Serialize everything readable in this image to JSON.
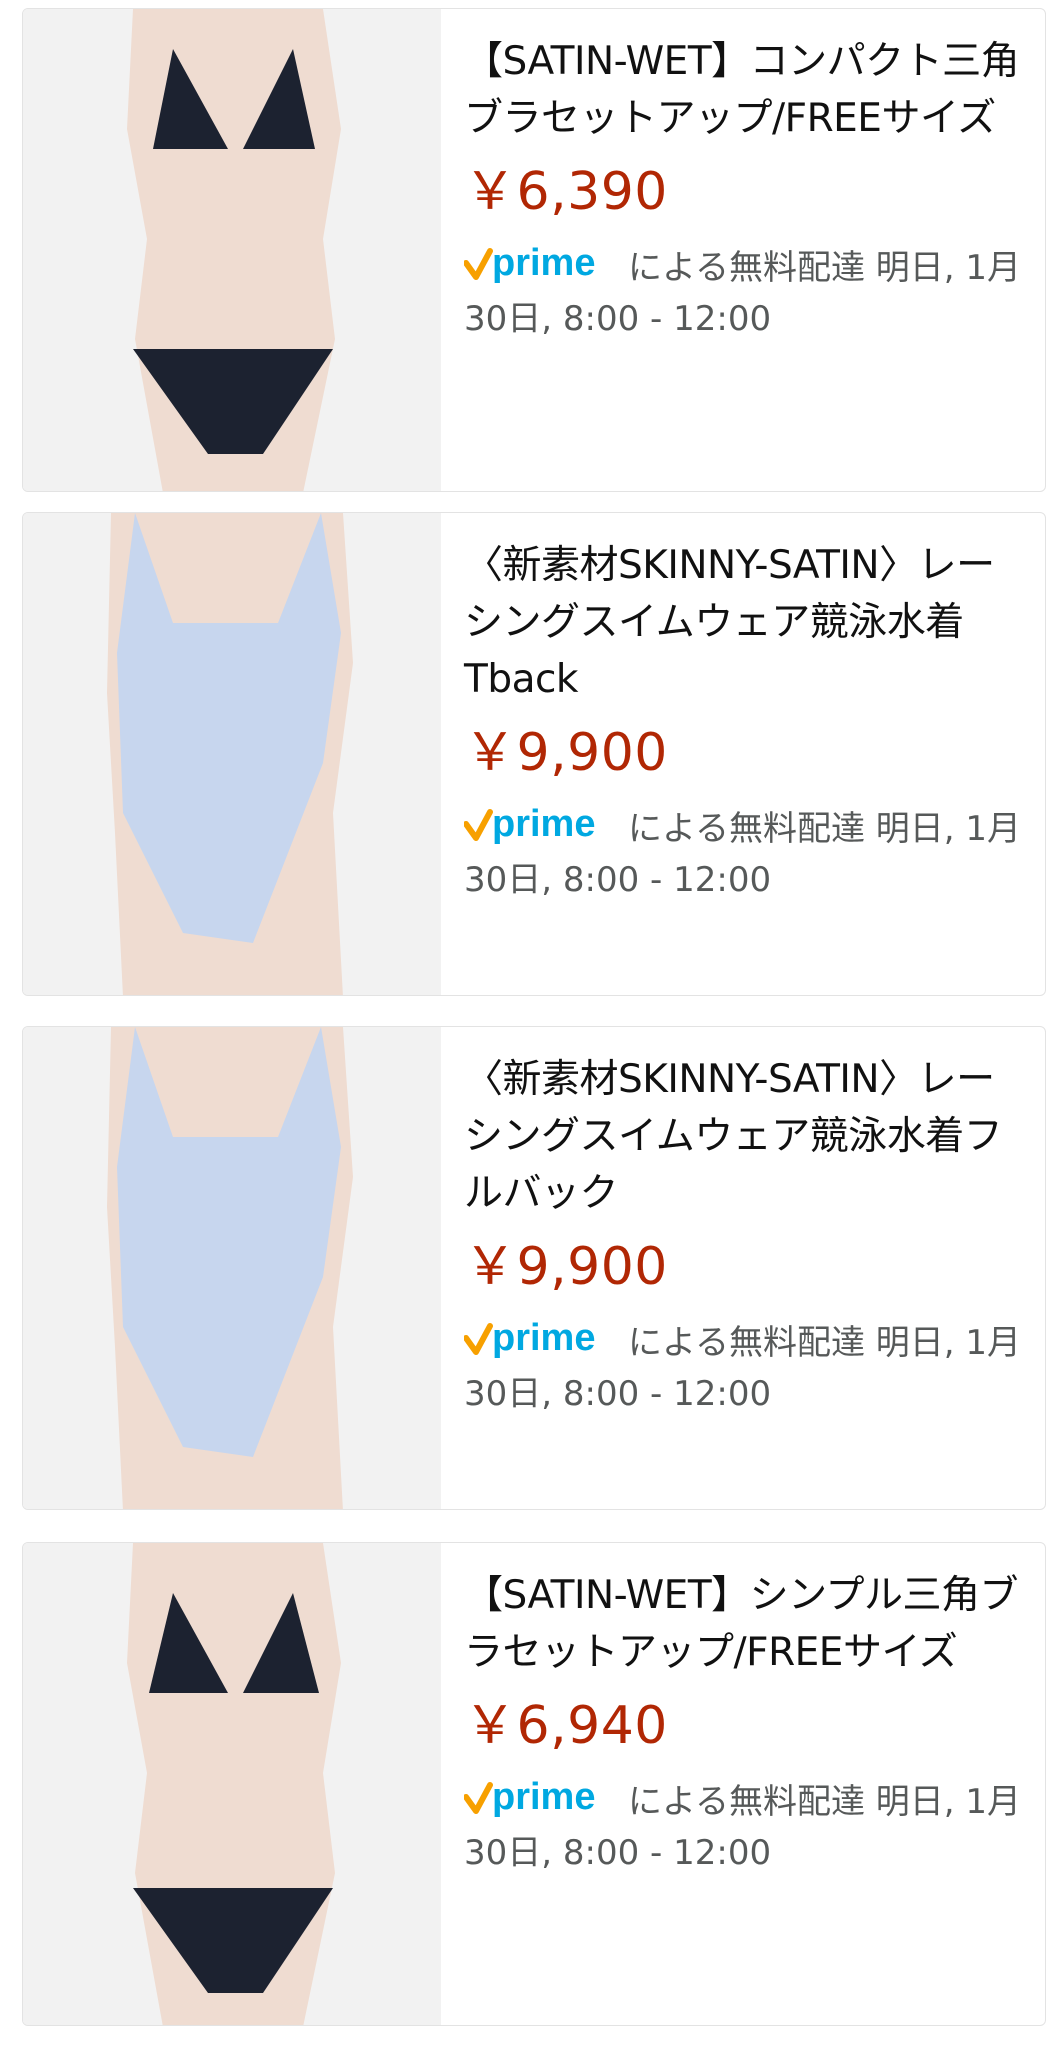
{
  "products": [
    {
      "title": "【SATIN-WET】コンパクト三角ブラセットアップ/FREEサイズ",
      "price": "￥6,390",
      "delivery_badge": "prime",
      "delivery_text": "による無料配達 明日, 1月30日, 8:00 - 12:00",
      "image": "black-triangle-bikini-photo"
    },
    {
      "title": "〈新素材SKINNY-SATIN〉レーシングスイムウェア競泳水着Tback",
      "price": "￥9,900",
      "delivery_badge": "prime",
      "delivery_text": "による無料配達 明日, 1月30日, 8:00 - 12:00",
      "image": "light-blue-swimsuit-photo"
    },
    {
      "title": "〈新素材SKINNY-SATIN〉レーシングスイムウェア競泳水着フルバック",
      "price": "￥9,900",
      "delivery_badge": "prime",
      "delivery_text": "による無料配達 明日, 1月30日, 8:00 - 12:00",
      "image": "light-blue-swimsuit-photo"
    },
    {
      "title": "【SATIN-WET】シンプル三角ブラセットアップ/FREEサイズ",
      "price": "￥6,940",
      "delivery_badge": "prime",
      "delivery_text": "による無料配達 明日, 1月30日, 8:00 - 12:00",
      "image": "black-triangle-bikini-photo"
    }
  ],
  "colors": {
    "price": "#b12704",
    "prime_blue": "#00a8e1",
    "prime_check": "#f7a000",
    "text": "#111111",
    "muted": "#565959"
  }
}
